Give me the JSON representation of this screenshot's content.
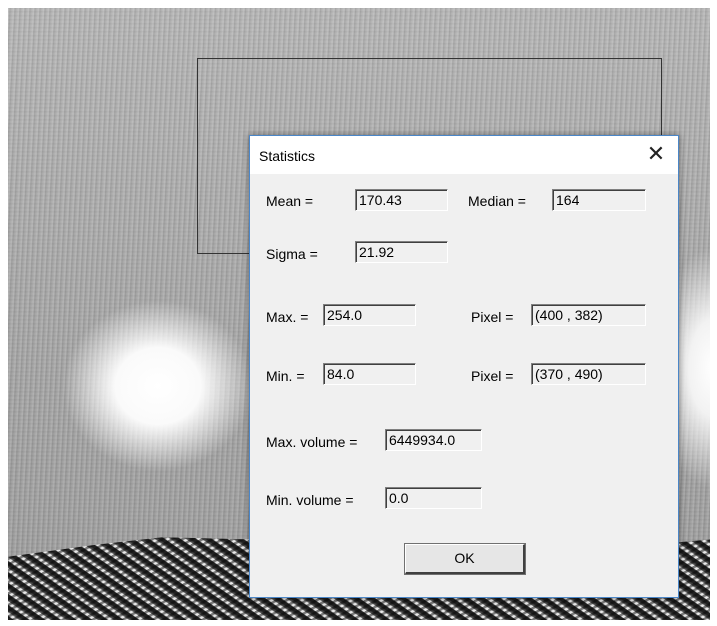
{
  "dialog": {
    "title": "Statistics",
    "close_glyph": "✕",
    "ok_label": "OK"
  },
  "stats": {
    "mean_label": "Mean =",
    "mean_value": "170.43",
    "median_label": "Median =",
    "median_value": "164",
    "sigma_label": "Sigma =",
    "sigma_value": "21.92",
    "max_label": "Max. =",
    "max_value": "254.0",
    "max_pixel_label": "Pixel =",
    "max_pixel_value": "(400 , 382)",
    "min_label": "Min. =",
    "min_value": "84.0",
    "min_pixel_label": "Pixel =",
    "min_pixel_value": "(370 , 490)",
    "max_volume_label": "Max. volume =",
    "max_volume_value": "6449934.0",
    "min_volume_label": "Min. volume =",
    "min_volume_value": "0.0"
  },
  "icons": {
    "close": "close-icon"
  }
}
